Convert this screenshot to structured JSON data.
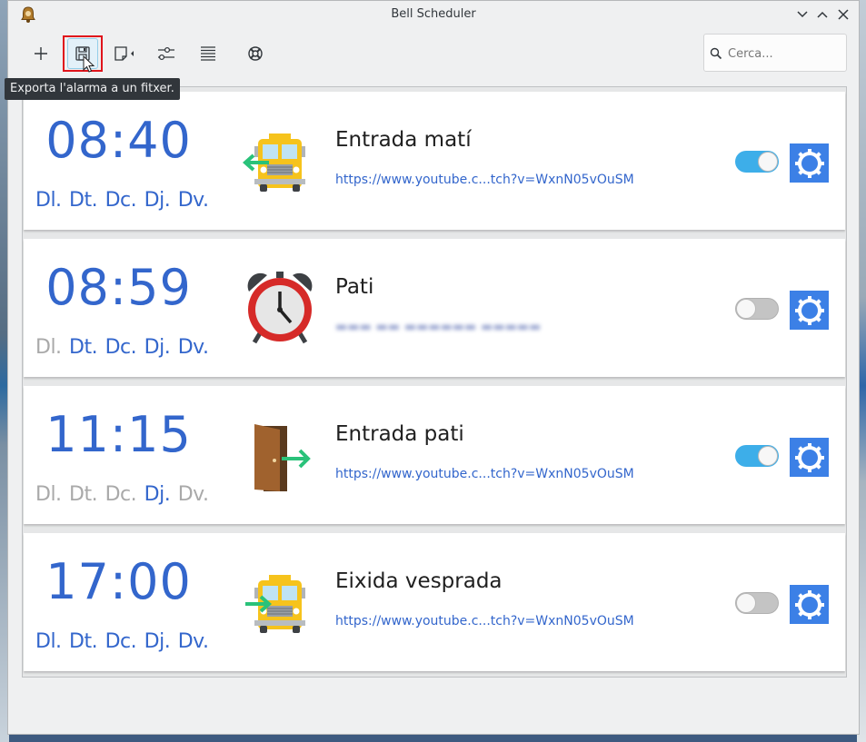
{
  "window": {
    "title": "Bell Scheduler"
  },
  "toolbar": {
    "search_placeholder": "Cerca...",
    "tooltip": "Exporta l'alarma a un fitxer.",
    "buttons": [
      "add-icon",
      "save-icon",
      "import-icon",
      "settings-sliders-icon",
      "list-icon",
      "help-icon"
    ]
  },
  "colors": {
    "accent": "#3366cc",
    "toggle_on": "#3daee9",
    "settings_button": "#3c80e6",
    "highlight": "#e0141b"
  },
  "alarms": [
    {
      "time": "08:40",
      "days": [
        {
          "label": "Dl.",
          "active": true
        },
        {
          "label": "Dt.",
          "active": true
        },
        {
          "label": "Dc.",
          "active": true
        },
        {
          "label": "Dj.",
          "active": true
        },
        {
          "label": "Dv.",
          "active": true
        }
      ],
      "icon": "bus-in-icon",
      "name": "Entrada matí",
      "sound": "https://www.youtube.c...tch?v=WxnN05vOuSM",
      "enabled": true
    },
    {
      "time": "08:59",
      "days": [
        {
          "label": "Dl.",
          "active": false
        },
        {
          "label": "Dt.",
          "active": true
        },
        {
          "label": "Dc.",
          "active": true
        },
        {
          "label": "Dj.",
          "active": true
        },
        {
          "label": "Dv.",
          "active": true
        }
      ],
      "icon": "alarm-clock-icon",
      "name": "Pati",
      "sound": "",
      "enabled": false
    },
    {
      "time": "11:15",
      "days": [
        {
          "label": "Dl.",
          "active": false
        },
        {
          "label": "Dt.",
          "active": false
        },
        {
          "label": "Dc.",
          "active": false
        },
        {
          "label": "Dj.",
          "active": true
        },
        {
          "label": "Dv.",
          "active": false
        }
      ],
      "icon": "door-in-icon",
      "name": "Entrada pati",
      "sound": "https://www.youtube.c...tch?v=WxnN05vOuSM",
      "enabled": true
    },
    {
      "time": "17:00",
      "days": [
        {
          "label": "Dl.",
          "active": true
        },
        {
          "label": "Dt.",
          "active": true
        },
        {
          "label": "Dc.",
          "active": true
        },
        {
          "label": "Dj.",
          "active": true
        },
        {
          "label": "Dv.",
          "active": true
        }
      ],
      "icon": "bus-out-icon",
      "name": "Eixida vesprada",
      "sound": "https://www.youtube.c...tch?v=WxnN05vOuSM",
      "enabled": false
    }
  ]
}
